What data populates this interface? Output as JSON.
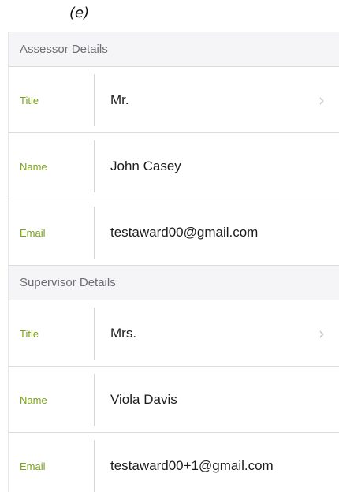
{
  "figure_label": "(e)",
  "colors": {
    "label_green": "#7aa21c",
    "header_bg": "#f5f5f7",
    "chevron": "#c4c4c7"
  },
  "assessor": {
    "header": "Assessor Details",
    "title_label": "Title",
    "title_value": "Mr.",
    "name_label": "Name",
    "name_value": "John Casey",
    "email_label": "Email",
    "email_value": "testaward00@gmail.com"
  },
  "supervisor": {
    "header": "Supervisor Details",
    "title_label": "Title",
    "title_value": "Mrs.",
    "name_label": "Name",
    "name_value": "Viola Davis",
    "email_label": "Email",
    "email_value": "testaward00+1@gmail.com"
  },
  "chevron_glyph": "›",
  "chevron_icon": "chevron-right-icon"
}
